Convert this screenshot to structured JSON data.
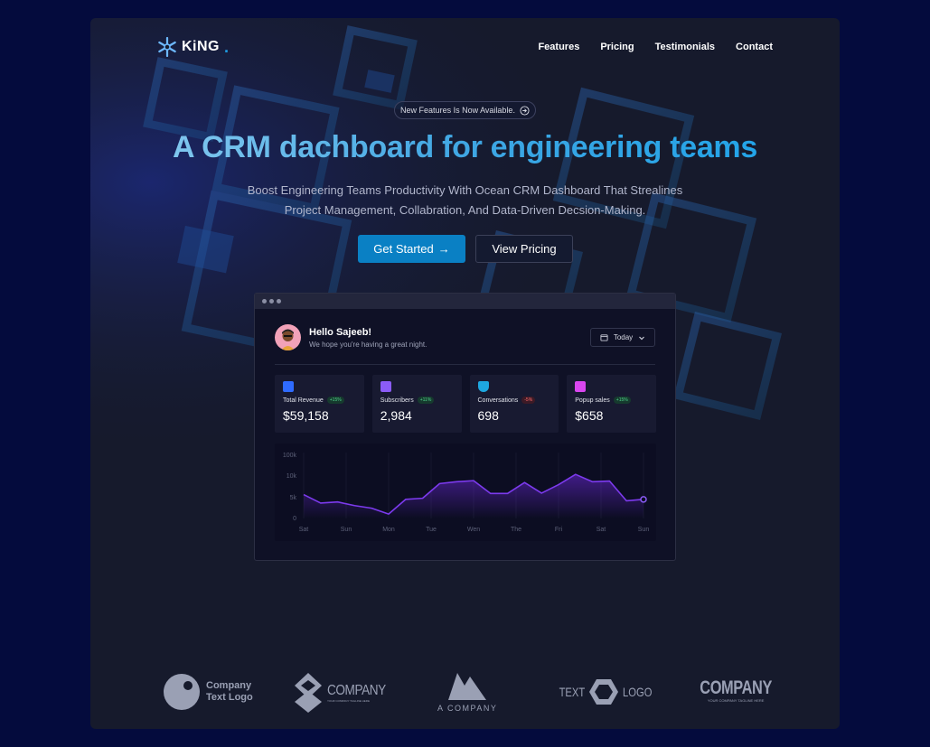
{
  "brand": {
    "name": "KiNG",
    "dot": "."
  },
  "nav": {
    "links": [
      "Features",
      "Pricing",
      "Testimonials",
      "Contact"
    ]
  },
  "hero": {
    "badge": "New Features Is Now Available.",
    "title": "A CRM dachboard for engineering teams",
    "subtitle_line1": "Boost Engineering Teams Productivity With Ocean CRM Dashboard That Strealines",
    "subtitle_line2": "Project Management, Collabration, And Data-Driven Decsion-Making.",
    "primary_button": "Get Started",
    "primary_arrow": "→",
    "secondary_button": "View Pricing"
  },
  "dashboard": {
    "greeting": "Hello Sajeeb!",
    "greeting_sub": "We hope you're having a great night.",
    "date_filter": "Today",
    "stats": [
      {
        "label": "Total Revenue",
        "delta": "+15%",
        "value": "$59,158",
        "color": "#2f6bff"
      },
      {
        "label": "Subscribers",
        "delta": "+11%",
        "value": "2,984",
        "color": "#8b5cf6"
      },
      {
        "label": "Conversations",
        "delta": "-5%",
        "value": "698",
        "color": "#1ea7e0"
      },
      {
        "label": "Popup sales",
        "delta": "+15%",
        "value": "$658",
        "color": "#d946ef"
      }
    ]
  },
  "chart_data": {
    "type": "area",
    "categories": [
      "Sat",
      "Sun",
      "Mon",
      "Tue",
      "Wen",
      "The",
      "Fri",
      "Sat",
      "Sun"
    ],
    "y_ticks": [
      "100k",
      "10k",
      "5k",
      "0"
    ],
    "series": [
      {
        "values": [
          6.5,
          4.2,
          4.5,
          3.5,
          2.8,
          1.2,
          5.2,
          5.5,
          9.5,
          10,
          10.3,
          6.8,
          6.8,
          9.8,
          6.9,
          9.2,
          12,
          10,
          10.2,
          4.8,
          5.2
        ]
      }
    ],
    "grid": false
  },
  "partner_logos": [
    {
      "name": "company-text-logo",
      "line1": "Company",
      "line2": "Text Logo"
    },
    {
      "name": "company-diamond-logo",
      "text": "COMPANY",
      "tagline": "YOUR COMPANY TAGLINE HERE"
    },
    {
      "name": "a-company-logo",
      "text": "A COMPANY"
    },
    {
      "name": "text-logo-hex",
      "left": "TEXT",
      "right": "LOGO"
    },
    {
      "name": "company-bold-logo",
      "text": "COMPANY",
      "tagline": "YOUR COMPANY TAGLINE HERE"
    }
  ],
  "colors": {
    "accent": "#0a80c4",
    "background": "#040b3d",
    "panel": "#161a2c",
    "chart_line": "#7c3aed"
  }
}
